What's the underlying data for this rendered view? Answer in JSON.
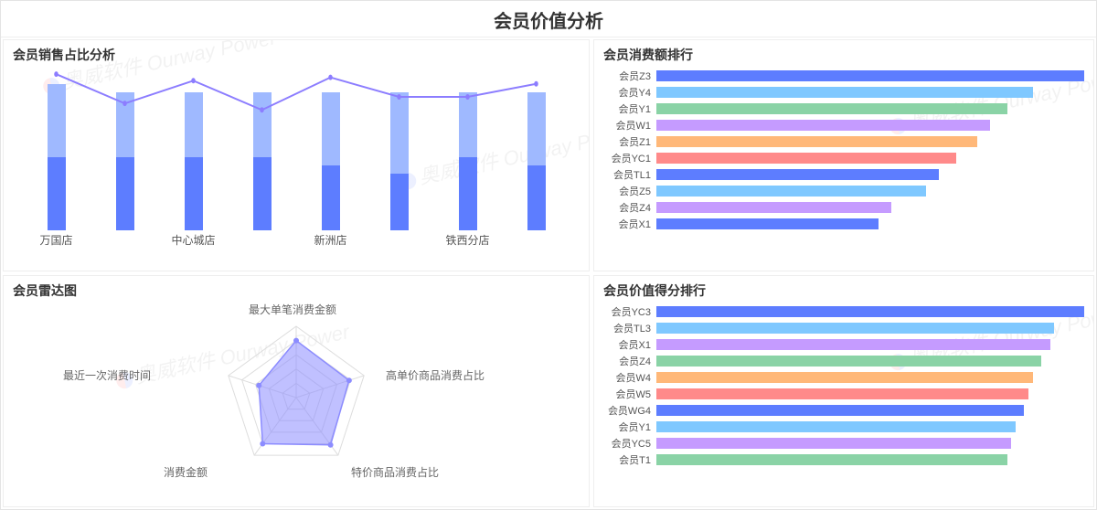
{
  "page_title": "会员价值分析",
  "watermark_cn": "奥威软件",
  "watermark_en": "Ourway Power",
  "panels": {
    "sales_ratio": {
      "title": "会员销售占比分析"
    },
    "spend_rank": {
      "title": "会员消费额排行"
    },
    "radar": {
      "title": "会员雷达图"
    },
    "score_rank": {
      "title": "会员价值得分排行"
    }
  },
  "chart_data": {
    "sales_ratio": {
      "type": "bar+line",
      "categories": [
        "万国店",
        "",
        "中心城店",
        "",
        "新洲店",
        "",
        "铁西分店",
        ""
      ],
      "bars": {
        "lower": [
          45,
          45,
          45,
          45,
          40,
          35,
          45,
          40
        ],
        "upper": [
          45,
          40,
          40,
          40,
          45,
          50,
          40,
          45
        ]
      },
      "line": [
        96,
        78,
        92,
        74,
        94,
        82,
        82,
        90
      ],
      "ylim": [
        0,
        100
      ],
      "colors": {
        "lower": "#5d7dff",
        "upper": "#9fb9ff",
        "line": "#8c7dff"
      }
    },
    "spend_rank": {
      "type": "bar-horizontal",
      "items": [
        {
          "label": "会员Z3",
          "value": 100,
          "color": "#5d7dff"
        },
        {
          "label": "会员Y4",
          "value": 88,
          "color": "#7fc8ff"
        },
        {
          "label": "会员Y1",
          "value": 82,
          "color": "#8ad3a6"
        },
        {
          "label": "会员W1",
          "value": 78,
          "color": "#c59bff"
        },
        {
          "label": "会员Z1",
          "value": 75,
          "color": "#ffb879"
        },
        {
          "label": "会员YC1",
          "value": 70,
          "color": "#ff8a8a"
        },
        {
          "label": "会员TL1",
          "value": 66,
          "color": "#5d7dff"
        },
        {
          "label": "会员Z5",
          "value": 63,
          "color": "#7fc8ff"
        },
        {
          "label": "会员Z4",
          "value": 55,
          "color": "#c59bff"
        },
        {
          "label": "会员X1",
          "value": 52,
          "color": "#5d7dff"
        }
      ],
      "xlim": [
        0,
        100
      ]
    },
    "radar": {
      "type": "radar",
      "axes": [
        "最大单笔消费金额",
        "高单价商品消费占比",
        "特价商品消费占比",
        "消费金额",
        "最近一次消费时间"
      ],
      "values": [
        80,
        78,
        82,
        80,
        55
      ],
      "max": 100,
      "rings": 5,
      "color": "#8c8cff"
    },
    "score_rank": {
      "type": "bar-horizontal",
      "items": [
        {
          "label": "会员YC3",
          "value": 100,
          "color": "#5d7dff"
        },
        {
          "label": "会员TL3",
          "value": 93,
          "color": "#7fc8ff"
        },
        {
          "label": "会员X1",
          "value": 92,
          "color": "#c59bff"
        },
        {
          "label": "会员Z4",
          "value": 90,
          "color": "#8ad3a6"
        },
        {
          "label": "会员W4",
          "value": 88,
          "color": "#ffb879"
        },
        {
          "label": "会员W5",
          "value": 87,
          "color": "#ff8a8a"
        },
        {
          "label": "会员WG4",
          "value": 86,
          "color": "#5d7dff"
        },
        {
          "label": "会员Y1",
          "value": 84,
          "color": "#7fc8ff"
        },
        {
          "label": "会员YC5",
          "value": 83,
          "color": "#c59bff"
        },
        {
          "label": "会员T1",
          "value": 82,
          "color": "#8ad3a6"
        }
      ],
      "xlim": [
        0,
        100
      ]
    }
  }
}
